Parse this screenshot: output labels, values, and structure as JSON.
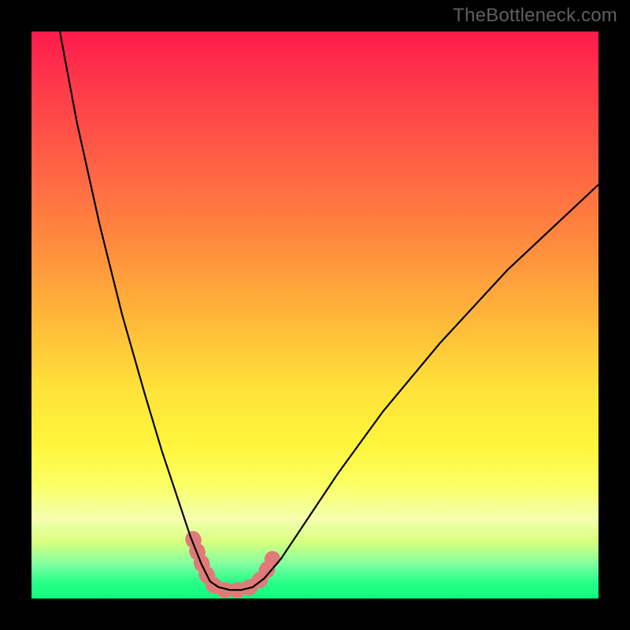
{
  "watermark": "TheBottleneck.com",
  "chart_data": {
    "type": "line",
    "title": "",
    "xlabel": "",
    "ylabel": "",
    "xlim": [
      0,
      100
    ],
    "ylim": [
      0,
      100
    ],
    "grid": false,
    "legend": false,
    "series": [
      {
        "name": "bottleneck-curve",
        "color": "#000000",
        "x": [
          5,
          8,
          12,
          16,
          20,
          23,
          26,
          28,
          30,
          31.5,
          33,
          35,
          37,
          39,
          41,
          44,
          48,
          54,
          62,
          72,
          84,
          100
        ],
        "y": [
          100,
          84,
          66,
          50,
          36,
          26,
          17,
          11,
          6,
          3,
          2,
          1.5,
          1.5,
          2,
          3.5,
          7,
          13,
          22,
          33,
          45,
          58,
          73
        ]
      },
      {
        "name": "highlight-dots",
        "color": "#e07a78",
        "x": [
          28.5,
          29.5,
          30.5,
          31.5,
          32.5,
          33.5,
          34.5,
          35.5,
          36.5,
          37.5,
          38.5,
          39.5,
          40.5,
          41.5,
          42.5
        ],
        "y": [
          10.5,
          7.5,
          5.0,
          3.0,
          2.0,
          1.5,
          1.5,
          1.5,
          1.5,
          1.5,
          2.0,
          2.5,
          3.5,
          5.0,
          7.0
        ]
      }
    ]
  }
}
